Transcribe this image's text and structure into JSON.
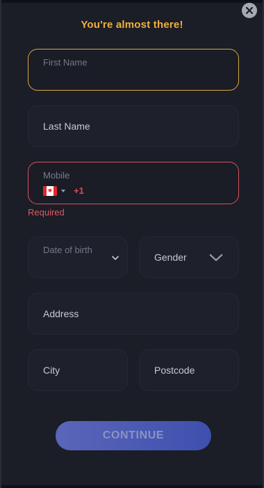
{
  "form": {
    "title": "You're almost there!",
    "fields": {
      "first_name": {
        "placeholder": "First Name"
      },
      "last_name": {
        "placeholder": "Last Name"
      },
      "mobile": {
        "label": "Mobile",
        "country_flag": "canada-flag-icon",
        "dial_code": "+1",
        "error": "Required"
      },
      "date_of_birth": {
        "label": "Date of birth"
      },
      "gender": {
        "label": "Gender"
      },
      "address": {
        "placeholder": "Address"
      },
      "city": {
        "placeholder": "City"
      },
      "postcode": {
        "placeholder": "Postcode"
      }
    },
    "continue_label": "CONTINUE"
  },
  "colors": {
    "accent": "#f0b13c",
    "error": "#e2585f",
    "button": "#4f5cb6"
  }
}
